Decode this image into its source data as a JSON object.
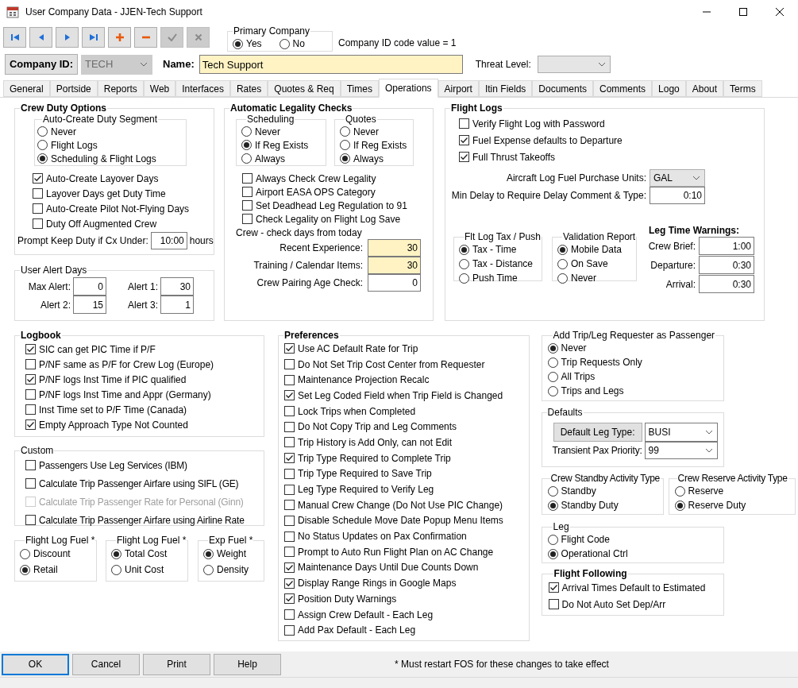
{
  "window": {
    "title": "User Company Data - JJEN-Tech Support"
  },
  "toolbar_buttons": [
    {
      "kind": "first",
      "disabled": false
    },
    {
      "kind": "previous",
      "disabled": false
    },
    {
      "kind": "next",
      "disabled": false
    },
    {
      "kind": "last",
      "disabled": false
    },
    {
      "kind": "add",
      "disabled": false
    },
    {
      "kind": "remove",
      "disabled": false
    },
    {
      "kind": "confirm",
      "disabled": true
    },
    {
      "kind": "cancel",
      "disabled": true
    }
  ],
  "primary_company": {
    "title": "Primary Company",
    "options": [
      {
        "label": "Yes",
        "selected": true
      },
      {
        "label": "No",
        "selected": false
      }
    ]
  },
  "company_id_code": "Company ID code value = 1",
  "company_id": {
    "label": "Company ID:",
    "value": "TECH",
    "disabled": true
  },
  "name": {
    "label": "Name:",
    "value": "Tech Support",
    "required": true
  },
  "threat_level": {
    "label": "Threat Level:"
  },
  "tabs": [
    {
      "label": "General",
      "selected": false
    },
    {
      "label": "Portside",
      "selected": false
    },
    {
      "label": "Reports",
      "selected": false
    },
    {
      "label": "Web",
      "selected": false
    },
    {
      "label": "Interfaces",
      "selected": false
    },
    {
      "label": "Rates",
      "selected": false
    },
    {
      "label": "Quotes & Req",
      "selected": false
    },
    {
      "label": "Times",
      "selected": false
    },
    {
      "label": "Operations",
      "selected": true
    },
    {
      "label": "Airport",
      "selected": false
    },
    {
      "label": "Itin Fields",
      "selected": false
    },
    {
      "label": "Documents",
      "selected": false
    },
    {
      "label": "Comments",
      "selected": false
    },
    {
      "label": "Logo",
      "selected": false
    },
    {
      "label": "About",
      "selected": false
    },
    {
      "label": "Terms",
      "selected": false
    }
  ],
  "crew_duty_options": {
    "title": "Crew Duty Options",
    "duty_segment": {
      "title": "Auto-Create Duty Segment",
      "options": [
        {
          "label": "Never",
          "selected": false
        },
        {
          "label": "Flight Logs",
          "selected": false
        },
        {
          "label": "Scheduling & Flight Logs",
          "selected": true
        }
      ]
    },
    "checkboxes": [
      {
        "label": "Auto-Create Layover Days",
        "checked": true
      },
      {
        "label": "Layover Days get Duty Time",
        "checked": false
      },
      {
        "label": "Auto-Create Pilot Not-Flying Days",
        "checked": false
      },
      {
        "label": "Duty Off Augmented Crew",
        "checked": false
      }
    ],
    "keep_duty": {
      "label": "Prompt Keep Duty if Cx Under:",
      "value": "10:00",
      "unit": "hours"
    }
  },
  "user_alert_days": {
    "title": "User Alert Days",
    "fields": [
      {
        "label": "Max Alert:",
        "value": "0"
      },
      {
        "label": "Alert 1:",
        "value": "30"
      },
      {
        "label": "Alert 2:",
        "value": "15"
      },
      {
        "label": "Alert 3:",
        "value": "1"
      }
    ]
  },
  "automatic_legality_checks": {
    "title": "Automatic Legality Checks",
    "scheduling": {
      "title": "Scheduling",
      "options": [
        {
          "label": "Never",
          "selected": false
        },
        {
          "label": "If Reg Exists",
          "selected": true
        },
        {
          "label": "Always",
          "selected": false
        }
      ]
    },
    "quotes": {
      "title": "Quotes",
      "options": [
        {
          "label": "Never",
          "selected": false
        },
        {
          "label": "If Reg Exists",
          "selected": false
        },
        {
          "label": "Always",
          "selected": true
        }
      ]
    },
    "checkboxes": [
      {
        "label": "Always Check Crew Legality",
        "checked": false
      },
      {
        "label": "Airport EASA OPS Category",
        "checked": false
      },
      {
        "label": "Set Deadhead Leg Regulation to 91",
        "checked": false
      },
      {
        "label": "Check Legality on Flight Log Save",
        "checked": false
      }
    ],
    "crew_days_label": "Crew - check days from today",
    "fields": [
      {
        "label": "Recent Experience:",
        "value": "30",
        "required": true
      },
      {
        "label": "Training / Calendar Items:",
        "value": "30",
        "required": true
      },
      {
        "label": "Crew Pairing Age Check:",
        "value": "0",
        "required": false
      }
    ]
  },
  "flight_logs": {
    "title": "Flight Logs",
    "checkboxes": [
      {
        "label": "Verify Flight Log with Password",
        "checked": false
      },
      {
        "label": "Fuel Expense defaults to Departure",
        "checked": true
      },
      {
        "label": "Full Thrust Takeoffs",
        "checked": true
      }
    ],
    "fuel_units": {
      "label": "Aircraft Log Fuel Purchase Units:",
      "value": "GAL",
      "editable": false
    },
    "min_delay": {
      "label": "Min Delay to Require Delay Comment & Type:",
      "value": "0:10"
    },
    "tax_push": {
      "title": "Flt Log Tax / Push",
      "options": [
        {
          "label": "Tax - Time",
          "selected": true
        },
        {
          "label": "Tax - Distance",
          "selected": false
        },
        {
          "label": "Push Time",
          "selected": false
        }
      ]
    },
    "validation_report": {
      "title": "Validation Report",
      "options": [
        {
          "label": "Mobile Data",
          "selected": true
        },
        {
          "label": "On Save",
          "selected": false
        },
        {
          "label": "Never",
          "selected": false
        }
      ]
    },
    "leg_time_warnings": {
      "title": "Leg Time Warnings:",
      "fields": [
        {
          "label": "Crew Brief:",
          "value": "1:00"
        },
        {
          "label": "Departure:",
          "value": "0:30"
        },
        {
          "label": "Arrival:",
          "value": "0:30"
        }
      ]
    }
  },
  "logbook": {
    "title": "Logbook",
    "checkboxes": [
      {
        "label": "SIC can get PIC Time if P/F",
        "checked": true
      },
      {
        "label": "P/NF same as P/F for Crew Log (Europe)",
        "checked": false
      },
      {
        "label": "P/NF logs Inst Time if PIC qualified",
        "checked": true
      },
      {
        "label": "P/NF logs Inst Time and Appr (Germany)",
        "checked": false
      },
      {
        "label": "Inst Time set to P/F Time (Canada)",
        "checked": false
      },
      {
        "label": "Empty Approach Type Not Counted",
        "checked": true
      }
    ]
  },
  "custom": {
    "title": "Custom",
    "checkboxes": [
      {
        "label": "Passengers Use Leg Services (IBM)",
        "checked": false,
        "disabled": false
      },
      {
        "label": "Calculate Trip Passenger Airfare using SIFL (GE)",
        "checked": false,
        "disabled": false
      },
      {
        "label": "Calculate Trip Passenger Rate for Personal (Ginn)",
        "checked": false,
        "disabled": true
      },
      {
        "label": "Calculate Trip Passenger Airfare using Airline Rate",
        "checked": false,
        "disabled": false
      }
    ]
  },
  "fuel_groups": [
    {
      "title": "Flight Log Fuel *",
      "options": [
        {
          "label": "Discount",
          "selected": false
        },
        {
          "label": "Retail",
          "selected": true
        }
      ]
    },
    {
      "title": "Flight Log Fuel *",
      "options": [
        {
          "label": "Total Cost",
          "selected": true
        },
        {
          "label": "Unit Cost",
          "selected": false
        }
      ]
    },
    {
      "title": "Exp Fuel *",
      "options": [
        {
          "label": "Weight",
          "selected": true
        },
        {
          "label": "Density",
          "selected": false
        }
      ]
    }
  ],
  "preferences": {
    "title": "Preferences",
    "checkboxes": [
      {
        "label": "Use AC Default Rate for Trip",
        "checked": true
      },
      {
        "label": "Do Not Set Trip Cost Center from Requester",
        "checked": false
      },
      {
        "label": "Maintenance Projection Recalc",
        "checked": false
      },
      {
        "label": "Set Leg Coded Field when Trip Field is Changed",
        "checked": true
      },
      {
        "label": "Lock Trips when Completed",
        "checked": false
      },
      {
        "label": "Do Not Copy Trip and Leg Comments",
        "checked": false
      },
      {
        "label": "Trip History is Add Only, can not Edit",
        "checked": false
      },
      {
        "label": "Trip Type Required to Complete Trip",
        "checked": true
      },
      {
        "label": "Trip Type Required to Save Trip",
        "checked": false
      },
      {
        "label": "Leg Type Required to Verify Leg",
        "checked": false
      },
      {
        "label": "Manual Crew Change (Do Not Use PIC Change)",
        "checked": false
      },
      {
        "label": "Disable Schedule Move Date Popup Menu Items",
        "checked": false
      },
      {
        "label": "No Status Updates on Pax Confirmation",
        "checked": false
      },
      {
        "label": "Prompt to Auto Run Flight Plan on AC Change",
        "checked": false
      },
      {
        "label": "Maintenance Days Until Due Counts Down",
        "checked": true
      },
      {
        "label": "Display Range Rings in Google Maps",
        "checked": true
      },
      {
        "label": "Position Duty Warnings",
        "checked": true
      },
      {
        "label": "Assign Crew Default - Each Leg",
        "checked": false
      },
      {
        "label": "Add Pax Default - Each Leg",
        "checked": false
      }
    ]
  },
  "requester_as_passenger": {
    "title": "Add Trip/Leg Requester as Passenger",
    "options": [
      {
        "label": "Never",
        "selected": true
      },
      {
        "label": "Trip Requests Only",
        "selected": false
      },
      {
        "label": "All Trips",
        "selected": false
      },
      {
        "label": "Trips and Legs",
        "selected": false
      }
    ]
  },
  "defaults": {
    "title": "Defaults",
    "default_leg_type": {
      "label": "Default Leg Type:",
      "value": "BUSI",
      "editable": true
    },
    "transient_pax_priority": {
      "label": "Transient Pax Priority:",
      "value": "99",
      "editable": true
    }
  },
  "activity_types": [
    {
      "title": "Crew Standby Activity Type",
      "options": [
        {
          "label": "Standby",
          "selected": false
        },
        {
          "label": "Standby Duty",
          "selected": true
        }
      ]
    },
    {
      "title": "Crew Reserve Activity Type",
      "options": [
        {
          "label": "Reserve",
          "selected": false
        },
        {
          "label": "Reserve Duty",
          "selected": true
        }
      ]
    }
  ],
  "leg": {
    "title": "Leg",
    "options": [
      {
        "label": "Flight Code",
        "selected": false
      },
      {
        "label": "Operational Ctrl",
        "selected": true
      }
    ]
  },
  "flight_following": {
    "title": "Flight Following",
    "checkboxes": [
      {
        "label": "Arrival Times Default to Estimated",
        "checked": true
      },
      {
        "label": "Do Not Auto Set Dep/Arr",
        "checked": false
      }
    ]
  },
  "footer": {
    "buttons": [
      {
        "label": "OK",
        "default": true
      },
      {
        "label": "Cancel",
        "default": false
      },
      {
        "label": "Print",
        "default": false
      },
      {
        "label": "Help",
        "default": false
      }
    ],
    "note": "* Must restart FOS for these changes to take effect"
  }
}
